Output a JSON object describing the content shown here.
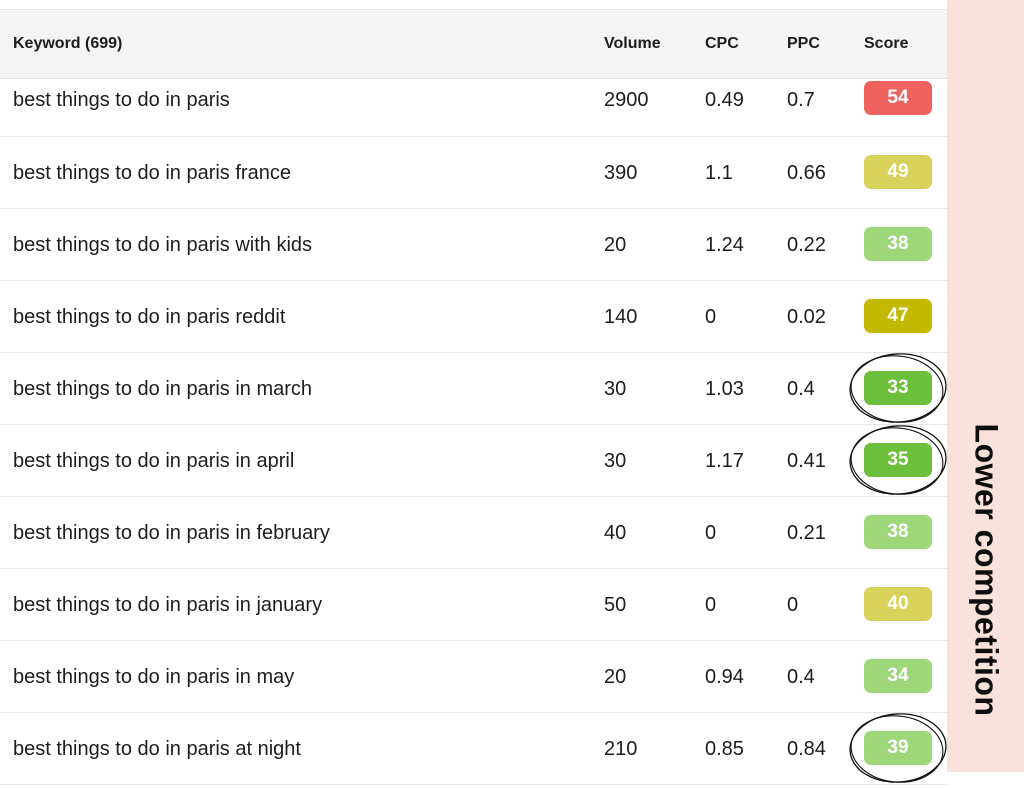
{
  "table": {
    "headers": {
      "keyword": "Keyword (699)",
      "volume": "Volume",
      "cpc": "CPC",
      "ppc": "PPC",
      "score": "Score"
    },
    "rows": [
      {
        "keyword": "best things to do in paris",
        "volume": "2900",
        "cpc": "0.49",
        "ppc": "0.7",
        "score": "54",
        "score_color": "#ee6360",
        "circled": false
      },
      {
        "keyword": "best things to do in paris france",
        "volume": "390",
        "cpc": "1.1",
        "ppc": "0.66",
        "score": "49",
        "score_color": "#d9d25a",
        "circled": false
      },
      {
        "keyword": "best things to do in paris with kids",
        "volume": "20",
        "cpc": "1.24",
        "ppc": "0.22",
        "score": "38",
        "score_color": "#9ed67a",
        "circled": false
      },
      {
        "keyword": "best things to do in paris reddit",
        "volume": "140",
        "cpc": "0",
        "ppc": "0.02",
        "score": "47",
        "score_color": "#c4b800",
        "circled": false
      },
      {
        "keyword": "best things to do in paris in march",
        "volume": "30",
        "cpc": "1.03",
        "ppc": "0.4",
        "score": "33",
        "score_color": "#6bbf3a",
        "circled": true
      },
      {
        "keyword": "best things to do in paris in april",
        "volume": "30",
        "cpc": "1.17",
        "ppc": "0.41",
        "score": "35",
        "score_color": "#6bbf3a",
        "circled": true
      },
      {
        "keyword": "best things to do in paris in february",
        "volume": "40",
        "cpc": "0",
        "ppc": "0.21",
        "score": "38",
        "score_color": "#9ed67a",
        "circled": false
      },
      {
        "keyword": "best things to do in paris in january",
        "volume": "50",
        "cpc": "0",
        "ppc": "0",
        "score": "40",
        "score_color": "#d9d25a",
        "circled": false
      },
      {
        "keyword": "best things to do in paris in may",
        "volume": "20",
        "cpc": "0.94",
        "ppc": "0.4",
        "score": "34",
        "score_color": "#9ed67a",
        "circled": false
      },
      {
        "keyword": "best things to do in paris at night",
        "volume": "210",
        "cpc": "0.85",
        "ppc": "0.84",
        "score": "39",
        "score_color": "#9ed67a",
        "circled": true
      }
    ]
  },
  "annotation": {
    "label": "Lower competition",
    "panel_color": "#f9e1dc"
  }
}
